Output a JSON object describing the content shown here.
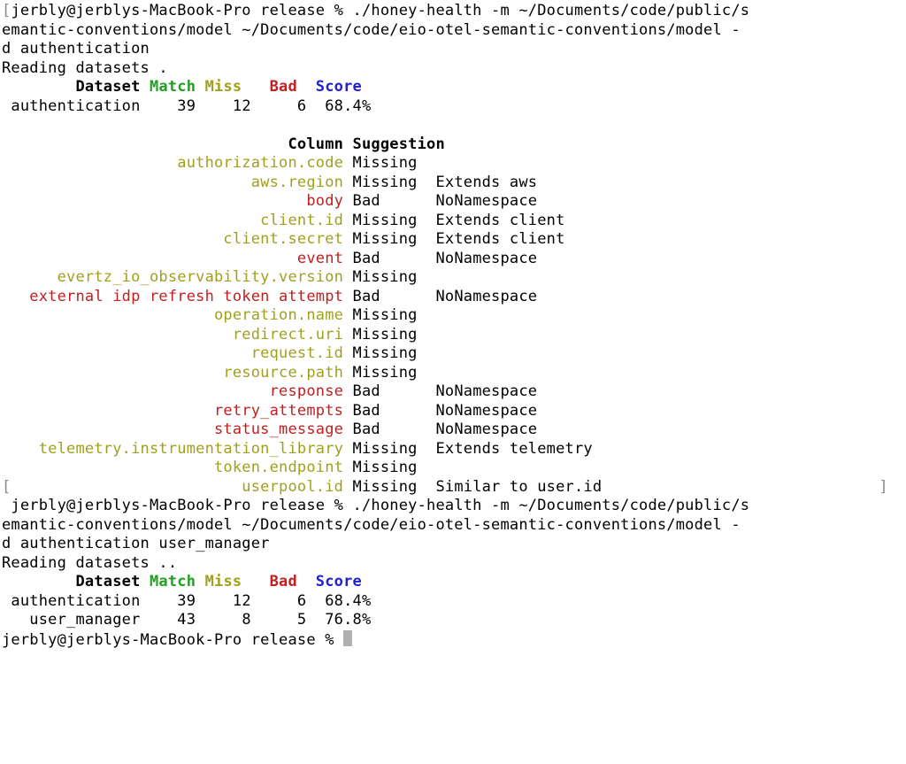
{
  "prompt1": {
    "open_bracket": "[",
    "close_bracket": "]",
    "host_pct": "jerbly@jerblys-MacBook-Pro release % ",
    "cmd_l1": "./honey-health -m ~/Documents/code/public/s",
    "cmd_l2": "emantic-conventions/model ~/Documents/code/eio-otel-semantic-conventions/model -",
    "cmd_l3": "d authentication"
  },
  "reading1": "Reading datasets .",
  "ds_header": {
    "dataset": "Dataset",
    "match": "Match",
    "miss": "Miss",
    "bad": "Bad",
    "score": "Score"
  },
  "ds1_rows": [
    {
      "name": "authentication",
      "match": "39",
      "miss": "12",
      "bad": "6",
      "score": "68.4%"
    }
  ],
  "col_header": {
    "col": "Column",
    "sug": "Suggestion"
  },
  "columns": [
    {
      "name": "authorization.code",
      "status": "Missing",
      "sug": "",
      "kind": "miss"
    },
    {
      "name": "aws.region",
      "status": "Missing",
      "sug": "Extends aws",
      "kind": "miss"
    },
    {
      "name": "body",
      "status": "Bad",
      "sug": "NoNamespace",
      "kind": "bad"
    },
    {
      "name": "client.id",
      "status": "Missing",
      "sug": "Extends client",
      "kind": "miss"
    },
    {
      "name": "client.secret",
      "status": "Missing",
      "sug": "Extends client",
      "kind": "miss"
    },
    {
      "name": "event",
      "status": "Bad",
      "sug": "NoNamespace",
      "kind": "bad"
    },
    {
      "name": "evertz_io_observability.version",
      "status": "Missing",
      "sug": "",
      "kind": "miss"
    },
    {
      "name": "external idp refresh token attempt",
      "status": "Bad",
      "sug": "NoNamespace",
      "kind": "bad"
    },
    {
      "name": "operation.name",
      "status": "Missing",
      "sug": "",
      "kind": "miss"
    },
    {
      "name": "redirect.uri",
      "status": "Missing",
      "sug": "",
      "kind": "miss"
    },
    {
      "name": "request.id",
      "status": "Missing",
      "sug": "",
      "kind": "miss"
    },
    {
      "name": "resource.path",
      "status": "Missing",
      "sug": "",
      "kind": "miss"
    },
    {
      "name": "response",
      "status": "Bad",
      "sug": "NoNamespace",
      "kind": "bad"
    },
    {
      "name": "retry_attempts",
      "status": "Bad",
      "sug": "NoNamespace",
      "kind": "bad"
    },
    {
      "name": "status_message",
      "status": "Bad",
      "sug": "NoNamespace",
      "kind": "bad"
    },
    {
      "name": "telemetry.instrumentation_library",
      "status": "Missing",
      "sug": "Extends telemetry",
      "kind": "miss"
    },
    {
      "name": "token.endpoint",
      "status": "Missing",
      "sug": "",
      "kind": "miss"
    },
    {
      "name": "userpool.id",
      "status": "Missing",
      "sug": "Similar to user.id",
      "kind": "miss"
    }
  ],
  "prompt2": {
    "open_bracket": "[",
    "close_bracket": "]",
    "cmd_l1": "./honey-health -m ~/Documents/code/public/s",
    "cmd_l2": "emantic-conventions/model ~/Documents/code/eio-otel-semantic-conventions/model -",
    "cmd_l3": "d authentication user_manager"
  },
  "reading2": "Reading datasets ..",
  "ds2_rows": [
    {
      "name": "authentication",
      "match": "39",
      "miss": "12",
      "bad": "6",
      "score": "68.4%"
    },
    {
      "name": "user_manager",
      "match": "43",
      "miss": "8",
      "bad": "5",
      "score": "76.8%"
    }
  ],
  "final_prompt": "jerbly@jerblys-MacBook-Pro release % "
}
